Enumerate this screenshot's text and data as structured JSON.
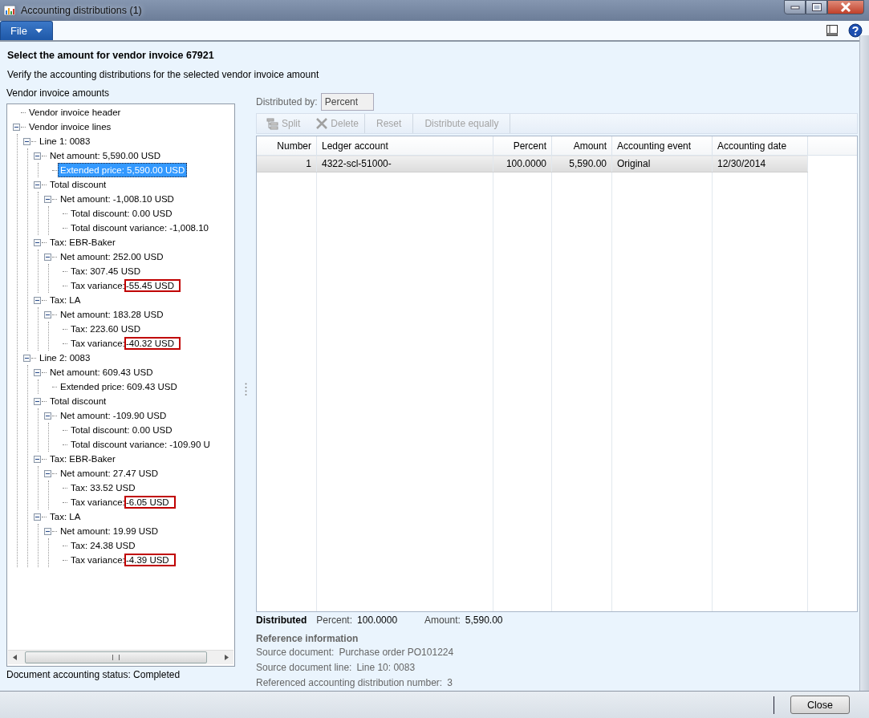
{
  "window": {
    "title": "Accounting distributions (1)"
  },
  "menu": {
    "file": "File"
  },
  "heading": "Select the amount for vendor invoice 67921",
  "subheading": "Verify the accounting distributions for the selected vendor invoice amount",
  "tree": {
    "label": "Vendor invoice amounts",
    "status": "Document accounting status: Completed",
    "items": [
      {
        "label": "Vendor invoice header",
        "selected": false
      },
      {
        "label": "Vendor invoice lines",
        "selected": false,
        "expanded": true,
        "children": [
          {
            "label": "Line 1: 0083",
            "selected": false,
            "expanded": true,
            "children": [
              {
                "label": "Net amount: 5,590.00 USD",
                "selected": false,
                "expanded": true,
                "children": [
                  {
                    "label": "Extended price: 5,590.00 USD",
                    "selected": true
                  }
                ]
              },
              {
                "label": "Total discount",
                "selected": false,
                "expanded": true,
                "children": [
                  {
                    "label": "Net amount: -1,008.10 USD",
                    "selected": false,
                    "expanded": true,
                    "children": [
                      {
                        "label": "Total discount: 0.00 USD",
                        "selected": false
                      },
                      {
                        "label": "Total discount variance: -1,008.10",
                        "selected": false
                      }
                    ]
                  }
                ]
              },
              {
                "label": "Tax: EBR-Baker",
                "selected": false,
                "expanded": true,
                "children": [
                  {
                    "label": "Net amount: 252.00 USD",
                    "selected": false,
                    "expanded": true,
                    "children": [
                      {
                        "label": "Tax: 307.45 USD",
                        "selected": false
                      },
                      {
                        "label": "Tax variance:",
                        "value": "-55.45 USD",
                        "highlighted": true,
                        "selected": false
                      }
                    ]
                  }
                ]
              },
              {
                "label": "Tax: LA",
                "selected": false,
                "expanded": true,
                "children": [
                  {
                    "label": "Net amount: 183.28 USD",
                    "selected": false,
                    "expanded": true,
                    "children": [
                      {
                        "label": "Tax: 223.60 USD",
                        "selected": false
                      },
                      {
                        "label": "Tax variance:",
                        "value": "-40.32 USD",
                        "highlighted": true,
                        "selected": false
                      }
                    ]
                  }
                ]
              }
            ]
          },
          {
            "label": "Line 2: 0083",
            "selected": false,
            "expanded": true,
            "children": [
              {
                "label": "Net amount: 609.43 USD",
                "selected": false,
                "expanded": true,
                "children": [
                  {
                    "label": "Extended price: 609.43 USD",
                    "selected": false
                  }
                ]
              },
              {
                "label": "Total discount",
                "selected": false,
                "expanded": true,
                "children": [
                  {
                    "label": "Net amount: -109.90 USD",
                    "selected": false,
                    "expanded": true,
                    "children": [
                      {
                        "label": "Total discount: 0.00 USD",
                        "selected": false
                      },
                      {
                        "label": "Total discount variance: -109.90 U",
                        "selected": false
                      }
                    ]
                  }
                ]
              },
              {
                "label": "Tax: EBR-Baker",
                "selected": false,
                "expanded": true,
                "children": [
                  {
                    "label": "Net amount: 27.47 USD",
                    "selected": false,
                    "expanded": true,
                    "children": [
                      {
                        "label": "Tax: 33.52 USD",
                        "selected": false
                      },
                      {
                        "label": "Tax variance:",
                        "value": "-6.05 USD",
                        "highlighted": true,
                        "selected": false
                      }
                    ]
                  }
                ]
              },
              {
                "label": "Tax: LA",
                "selected": false,
                "expanded": true,
                "children": [
                  {
                    "label": "Net amount: 19.99 USD",
                    "selected": false,
                    "expanded": true,
                    "children": [
                      {
                        "label": "Tax: 24.38 USD",
                        "selected": false
                      },
                      {
                        "label": "Tax variance:",
                        "value": "-4.39 USD",
                        "highlighted": true,
                        "selected": false
                      }
                    ]
                  }
                ]
              }
            ]
          }
        ]
      }
    ]
  },
  "distribution": {
    "label": "Distributed by:",
    "value": "Percent"
  },
  "toolbar": [
    {
      "kind": "split",
      "label": "Split",
      "disabled": true
    },
    {
      "kind": "delete",
      "label": "Delete",
      "disabled": true
    },
    {
      "kind": "text",
      "label": "Reset",
      "disabled": true
    },
    {
      "kind": "text",
      "label": "Distribute equally",
      "disabled": true
    }
  ],
  "grid": {
    "columns": [
      {
        "label": "Number",
        "kind": "number"
      },
      {
        "label": "Ledger account",
        "kind": "text"
      },
      {
        "label": "Percent",
        "kind": "number"
      },
      {
        "label": "Amount",
        "kind": "number"
      },
      {
        "label": "Accounting event",
        "kind": "text"
      },
      {
        "label": "Accounting date",
        "kind": "text"
      }
    ],
    "rows": [
      {
        "cells": [
          "1",
          "4322-scl-51000-",
          "100.0000",
          "5,590.00",
          "Original",
          "12/30/2014"
        ],
        "selected": true
      }
    ]
  },
  "summary": {
    "title": "Distributed",
    "items": [
      {
        "label": "Percent:",
        "value": "100.0000"
      },
      {
        "label": "Amount:",
        "value": "5,590.00"
      }
    ]
  },
  "reference": {
    "title": "Reference information",
    "items": [
      {
        "label": "Source document:",
        "value": "Purchase order PO101224"
      },
      {
        "label": "Source document line:",
        "value": "Line 10: 0083"
      },
      {
        "label": "Referenced accounting distribution number:",
        "value": "3"
      }
    ]
  },
  "buttons": [
    "Close"
  ]
}
